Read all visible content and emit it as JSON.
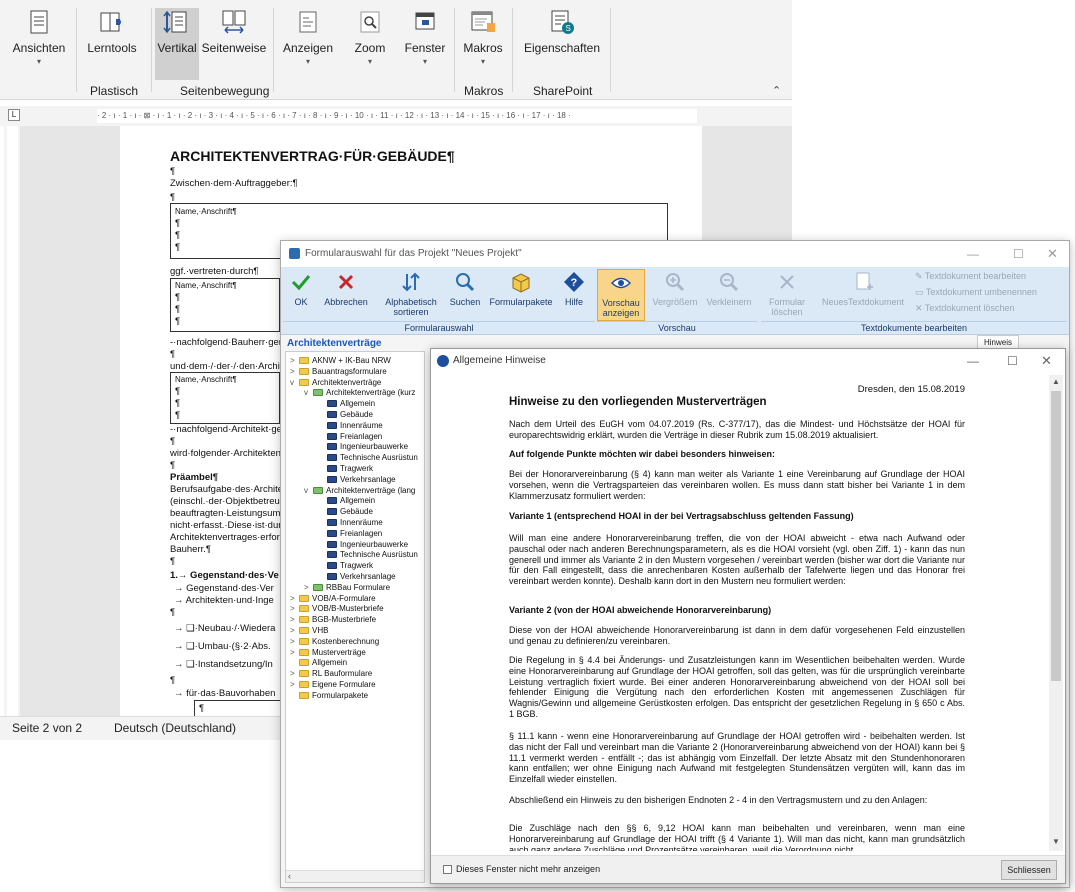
{
  "word": {
    "ribbon_buttons": {
      "ansichten": "Ansichten",
      "lerntools": "Lerntools",
      "vertikal": "Vertikal",
      "seitenweise": "Seitenweise",
      "anzeigen": "Anzeigen",
      "zoom": "Zoom",
      "fenster": "Fenster",
      "makros": "Makros",
      "eigenschaften": "Eigenschaften"
    },
    "ribbon_groups": {
      "plastisch": "Plastisch",
      "seitenbewegung": "Seitenbewegung",
      "makros": "Makros",
      "sharepoint": "SharePoint"
    },
    "ruler_text": "· 2 · ı · 1 · ı · ⊠ · ı · 1 · ı · 2 · ı · 3 · ı · 4 · ı · 5 · ı · 6 · ı · 7 · ı · 8 · ı · 9 · ı · 10 · ı · 11 · ı · 12 · ı · 13 · ı · 14 · ı · 15 · ı · 16 · ı · 17 · ı · 18 ·",
    "document": {
      "title": "ARCHITEKTENVERTRAG·FÜR·GEBÄUDE¶",
      "pilcrow": "¶",
      "zwischen": "Zwischen·dem·Auftraggeber:¶",
      "name_anschrift_1": "Name,·Anschrift¶",
      "ggf_vertreten": "ggf.·vertreten·durch¶",
      "name_anschrift_2": "Name,·Anschrift¶",
      "bauherr_gen": "-·nachfolgend·Bauherr·gen",
      "und_dem": "und·dem·/·der·/·den·Archit",
      "name_anschrift_3": "Name,·Anschrift¶",
      "architekt_ge": "-·nachfolgend·Architekt·ge",
      "wird_folgender": "wird·folgender·Architekten",
      "praeambel": "Präambel¶",
      "body_lines": [
        "Berufsaufgabe·des·Archite",
        "(einschl.·der·Objektbetreu",
        "beauftragten·Leistungsumf",
        "nicht·erfasst.·Diese·ist·durc",
        "Architektenvertrages·erforc",
        "Bauherr.¶"
      ],
      "section1": "1.→ Gegenstand·des·Ve",
      "arrow_lines": [
        "→ Gegenstand·des·Ver",
        "→ Architekten·und·Inge"
      ],
      "checkbox_lines": [
        "→ ❑·Neubau·/·Wiedera",
        "→ ❑·Umbau·(§·2·Abs.",
        "→ ❑·Instandsetzung/In"
      ],
      "bauvorhaben": "→ für·das·Bauvorhaben"
    },
    "status": {
      "page": "Seite 2 von 2",
      "language": "Deutsch (Deutschland)"
    }
  },
  "formular": {
    "title": "Formularauswahl für das Projekt \"Neues Projekt\"",
    "buttons": {
      "ok": "OK",
      "abbrechen": "Abbrechen",
      "alphabetisch": "Alphabetisch sortieren",
      "suchen": "Suchen",
      "formularpakete": "Formularpakete",
      "hilfe": "Hilfe",
      "vorschau": "Vorschau anzeigen",
      "vergroessern": "Vergrößern",
      "verkleinern": "Verkleinern",
      "formular_loeschen": "Formular löschen",
      "neues_textdokument": "NeuesTextdokument",
      "td_bearbeiten": "Textdokument bearbeiten",
      "td_umbenennen": "Textdokument umbenennen",
      "td_loeschen": "Textdokument löschen"
    },
    "groups": {
      "formularauswahl": "Formularauswahl",
      "vorschau": "Vorschau",
      "textdokumente": "Textdokumente bearbeiten"
    },
    "tab_hinweis": "Hinweis",
    "panel_title": "Architektenverträge",
    "tree": [
      {
        "label": "AKNW + IK-Bau NRW",
        "level": 0,
        "icon": "folder-yellow",
        "exp": ">"
      },
      {
        "label": "Bauantragsformulare",
        "level": 0,
        "icon": "folder-yellow",
        "exp": ">"
      },
      {
        "label": "Architektenverträge",
        "level": 0,
        "icon": "folder-yellow-open",
        "exp": "v"
      },
      {
        "label": "Architektenverträge (kurz",
        "level": 1,
        "icon": "folder-green",
        "exp": "v"
      },
      {
        "label": "Allgemein",
        "level": 2,
        "icon": "folder-blue",
        "exp": ""
      },
      {
        "label": "Gebäude",
        "level": 2,
        "icon": "folder-blue",
        "exp": ""
      },
      {
        "label": "Innenräume",
        "level": 2,
        "icon": "folder-blue",
        "exp": ""
      },
      {
        "label": "Freianlagen",
        "level": 2,
        "icon": "folder-blue",
        "exp": ""
      },
      {
        "label": "Ingenieurbauwerke",
        "level": 2,
        "icon": "folder-blue",
        "exp": ""
      },
      {
        "label": "Technische Ausrüstun",
        "level": 2,
        "icon": "folder-blue",
        "exp": ""
      },
      {
        "label": "Tragwerk",
        "level": 2,
        "icon": "folder-blue",
        "exp": ""
      },
      {
        "label": "Verkehrsanlage",
        "level": 2,
        "icon": "folder-blue",
        "exp": ""
      },
      {
        "label": "Architektenverträge (lang",
        "level": 1,
        "icon": "folder-green",
        "exp": "v"
      },
      {
        "label": "Allgemein",
        "level": 2,
        "icon": "folder-blue",
        "exp": ""
      },
      {
        "label": "Gebäude",
        "level": 2,
        "icon": "folder-blue",
        "exp": ""
      },
      {
        "label": "Innenräume",
        "level": 2,
        "icon": "folder-blue",
        "exp": ""
      },
      {
        "label": "Freianlagen",
        "level": 2,
        "icon": "folder-blue",
        "exp": ""
      },
      {
        "label": "Ingenieurbauwerke",
        "level": 2,
        "icon": "folder-blue",
        "exp": ""
      },
      {
        "label": "Technische Ausrüstun",
        "level": 2,
        "icon": "folder-blue",
        "exp": ""
      },
      {
        "label": "Tragwerk",
        "level": 2,
        "icon": "folder-blue",
        "exp": ""
      },
      {
        "label": "Verkehrsanlage",
        "level": 2,
        "icon": "folder-blue",
        "exp": ""
      },
      {
        "label": "RBBau Formulare",
        "level": 1,
        "icon": "folder-green",
        "exp": ">"
      },
      {
        "label": "VOB/A-Formulare",
        "level": 0,
        "icon": "folder-yellow",
        "exp": ">"
      },
      {
        "label": "VOB/B-Musterbriefe",
        "level": 0,
        "icon": "folder-yellow",
        "exp": ">"
      },
      {
        "label": "BGB-Musterbriefe",
        "level": 0,
        "icon": "folder-yellow",
        "exp": ">"
      },
      {
        "label": "VHB",
        "level": 0,
        "icon": "folder-yellow",
        "exp": ">"
      },
      {
        "label": "Kostenberechnung",
        "level": 0,
        "icon": "folder-yellow",
        "exp": ">"
      },
      {
        "label": "Musterverträge",
        "level": 0,
        "icon": "folder-yellow",
        "exp": ">"
      },
      {
        "label": "Allgemein",
        "level": 0,
        "icon": "folder-yellow",
        "exp": ""
      },
      {
        "label": "RL Bauformulare",
        "level": 0,
        "icon": "folder-yellow",
        "exp": ">"
      },
      {
        "label": "Eigene Formulare",
        "level": 0,
        "icon": "folder-yellow",
        "exp": ">"
      },
      {
        "label": "Formularpakete",
        "level": 0,
        "icon": "folder-yellow",
        "exp": ""
      }
    ]
  },
  "hinweise": {
    "window_title": "Allgemeine Hinweise",
    "date": "Dresden, den 15.08.2019",
    "heading": "Hinweise zu den vorliegenden Musterverträgen",
    "paragraphs": [
      "Nach dem Urteil des EuGH vom 04.07.2019 (Rs. C-377/17), das die Mindest- und Höchstsätze der HOAI für europarechtswidrig erklärt, wurden die Verträge in dieser Rubrik zum 15.08.2019 aktualisiert.",
      "Auf folgende Punkte möchten wir dabei besonders hinweisen:",
      "Bei der Honorarvereinbarung (§ 4) kann man weiter als Variante 1 eine Vereinbarung auf Grundlage der HOAI vorsehen, wenn die Vertragsparteien das vereinbaren wollen. Es muss dann statt bisher bei Variante 1 in dem Klammerzusatz formuliert werden:",
      "Variante 1 (entsprechend HOAI in der bei Vertragsabschluss geltenden Fassung)",
      "Will man eine andere Honorarvereinbarung treffen, die von der HOAI abweicht - etwa nach Aufwand oder pauschal oder nach anderen Berechnungsparametern, als es die HOAI vorsieht (vgl. oben Ziff. 1) - kann das nun generell und immer als Variante 2 in den Mustern vorgesehen / vereinbart werden (bisher war dort die Variante nur für den Fall eingestellt, dass die anrechenbaren Kosten außerhalb der Tafelwerte liegen und das Honorar frei vereinbart werden konnte). Deshalb kann dort in den Mustern neu formuliert werden:",
      "Variante 2 (von der HOAI abweichende Honorarvereinbarung)",
      "Diese von der HOAI abweichende Honorarvereinbarung ist dann in dem dafür vorgesehenen Feld einzustellen und genau zu definieren/zu vereinbaren.",
      "Die Regelung in § 4.4 bei Änderungs- und Zusatzleistungen kann im Wesentlichen beibehalten werden. Wurde eine Honorarvereinbarung auf Grundlage der HOAI getroffen, soll das gelten, was für die ursprünglich vereinbarte Leistung vertraglich fixiert wurde. Bei einer anderen Honorarvereinbarung abweichend von der HOAI soll bei fehlender Einigung die Vergütung nach den erforderlichen Kosten mit angemessenen Zuschlägen für Wagnis/Gewinn und allgemeine Gerüstkosten erfolgen. Das entspricht der gesetzlichen Regelung in § 650 c Abs. 1 BGB.",
      "§ 11.1 kann - wenn eine Honorarvereinbarung auf Grundlage der HOAI getroffen wird - beibehalten werden. Ist das nicht der Fall und vereinbart man die Variante 2 (Honorarvereinbarung abweichend von der HOAI) kann bei § 11.1 vermerkt werden - entfällt -; das ist abhängig vom Einzelfall. Der letzte Absatz mit den Stundenhonoraren kann entfallen; wer ohne Einigung nach Aufwand mit festgelegten Stundensätzen vergüten will, kann das im Einzelfall wieder einstellen.",
      "Abschließend ein Hinweis zu den bisherigen Endnoten 2 - 4 in den Vertragsmustern und zu den Anlagen:",
      "Die Zuschläge nach den §§ 6, 9,12 HOAI kann man beibehalten und vereinbaren, wenn man eine Honorarvereinbarung auf Grundlage der HOAI trifft (§ 4 Variante 1). Will man das nicht, kann man grundsätzlich auch ganz andere Zuschläge und Prozentsätze vereinbaren, weil die Verordnung nicht"
    ],
    "checkbox_label": "Dieses Fenster nicht mehr anzeigen",
    "close_button": "Schliessen"
  }
}
